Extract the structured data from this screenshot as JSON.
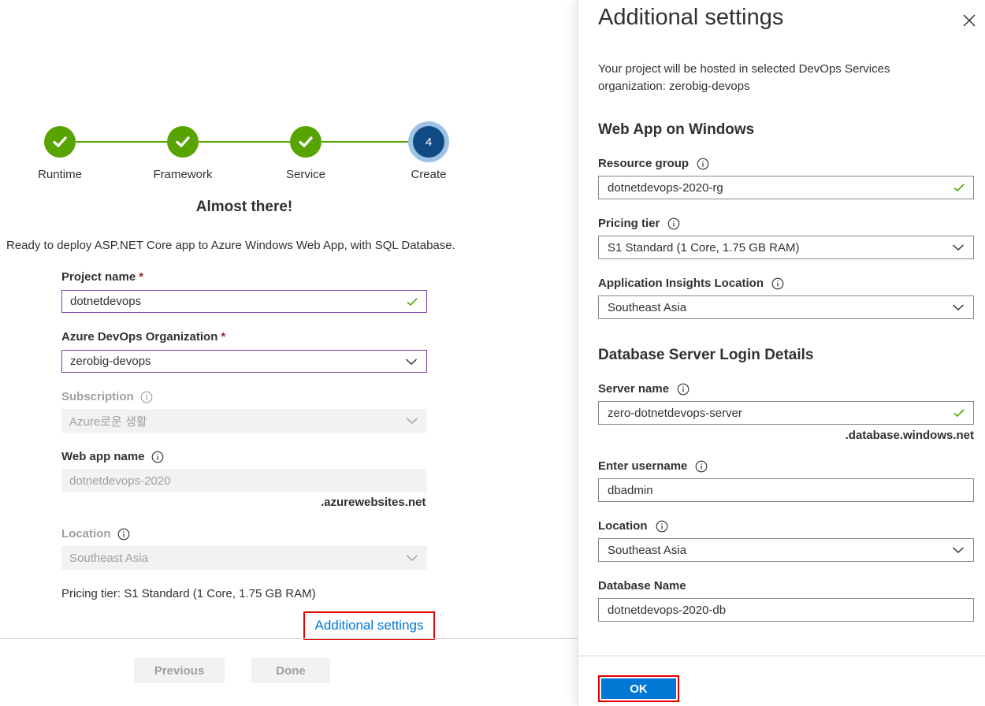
{
  "wizard": {
    "steps": [
      {
        "label": "Runtime",
        "state": "done"
      },
      {
        "label": "Framework",
        "state": "done"
      },
      {
        "label": "Service",
        "state": "done"
      },
      {
        "label": "Create",
        "state": "current",
        "number": "4"
      }
    ],
    "heading": "Almost there!",
    "ready_text": "Ready to deploy ASP.NET Core app to Azure Windows Web App, with SQL Database.",
    "project_name": {
      "label": "Project name",
      "required_mark": "*",
      "value": "dotnetdevops"
    },
    "devops_org": {
      "label": "Azure DevOps Organization",
      "required_mark": "*",
      "value": "zerobig-devops"
    },
    "subscription": {
      "label": "Subscription",
      "value": "Azure로운 생활"
    },
    "web_app_name": {
      "label": "Web app name",
      "value": "dotnetdevops-2020",
      "suffix": ".azurewebsites.net"
    },
    "location": {
      "label": "Location",
      "value": "Southeast Asia"
    },
    "pricing_tier_line": "Pricing tier: S1 Standard (1 Core, 1.75 GB RAM)",
    "additional_settings_link": "Additional settings",
    "previous_button": "Previous",
    "done_button": "Done"
  },
  "panel": {
    "title": "Additional settings",
    "intro": "Your project will be hosted in selected DevOps Services organization: zerobig-devops",
    "web_app_section": "Web App on Windows",
    "resource_group": {
      "label": "Resource group",
      "value": "dotnetdevops-2020-rg"
    },
    "pricing_tier": {
      "label": "Pricing tier",
      "value": "S1 Standard (1 Core, 1.75 GB RAM)"
    },
    "app_insights_location": {
      "label": "Application Insights Location",
      "value": "Southeast Asia"
    },
    "db_section": "Database Server Login Details",
    "server_name": {
      "label": "Server name",
      "value": "zero-dotnetdevops-server",
      "suffix": ".database.windows.net"
    },
    "username": {
      "label": "Enter username",
      "value": "dbadmin"
    },
    "db_location": {
      "label": "Location",
      "value": "Southeast Asia"
    },
    "db_name": {
      "label": "Database Name",
      "value": "dotnetdevops-2020-db"
    },
    "ok_button": "OK"
  },
  "colors": {
    "success_green": "#57a300",
    "current_step_blue": "#0f4a85",
    "accent_blue": "#0078d4",
    "highlight_red": "#e50000",
    "active_border_purple": "#7a3ea8"
  }
}
